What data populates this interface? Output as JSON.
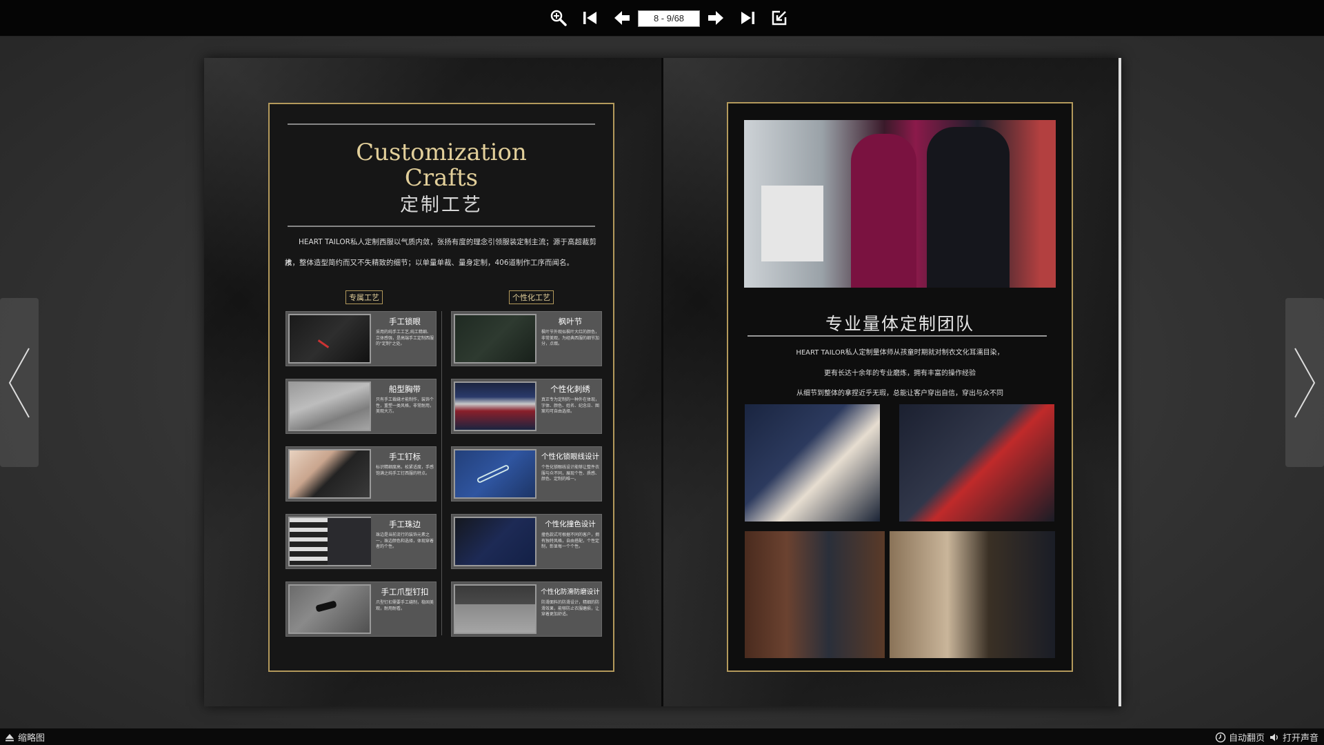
{
  "toolbar": {
    "page_indicator": "8 - 9/68",
    "buttons": [
      "zoom-in-icon",
      "first-page-icon",
      "prev-page-icon",
      "next-page-icon",
      "last-page-icon",
      "exit-fullscreen-icon"
    ]
  },
  "bottombar": {
    "thumbnails_label": "缩略图",
    "auto_flip_label": "自动翻页",
    "sound_label": "打开声音"
  },
  "left_page": {
    "title_en_1": "Customization",
    "title_en_2": "Crafts",
    "title_cn": "定制工艺",
    "intro_1": "HEART TAILOR私人定制西服以气质内敛，张扬有度的理念引领服装定制主流；源于高超裁剪技",
    "intro_2": "术，整体造型简约而又不失精致的细节；以单量单裁、量身定制，406道制作工序而闻名。",
    "col1_label": "专属工艺",
    "col2_label": "个性化工艺",
    "cards_left": [
      {
        "title": "手工锁眼",
        "desc": "采用的纯手工工艺,纯工精细、立体感强，是高端手工定制西服的\"定制\"之处。"
      },
      {
        "title": "船型胸带",
        "desc": "只有手工裁缝才能制作，装饰个性，重塑一类风格，非常耐用，美观大方。"
      },
      {
        "title": "手工钉标",
        "desc": "标识精细度高，松紧适度，手感饱满之纯手工钉西服的特点。"
      },
      {
        "title": "手工珠边",
        "desc": "珠边是当前流行的装饰元素之一，珠边颜色和选择，体现穿着者的个性。"
      },
      {
        "title": "手工爪型钉扣",
        "desc": "爪型钉扣需要手工缝制，稳固美观，耐用耐看。"
      }
    ],
    "cards_right": [
      {
        "title": "枫叶节",
        "desc": "枫叶节外观似枫叶大红的颜色，非常美观，为经典西服的细节加分，点缀。"
      },
      {
        "title": "个性化刺绣",
        "desc": "真正专为定制的一种外在体现，字体、颜色、姓名、纪念日、图案均可自由选择。"
      },
      {
        "title": "个性化锁眼线设计",
        "desc": "个性化锁眼线设计能够让整件衣服与众不同，展现个性、质感、颜色、定制的唯一。"
      },
      {
        "title": "个性化撞色设计",
        "desc": "撞色款式可根据不同的客户，拥有独特风格，自由搭配，个性定制，彰显每一个个性。"
      },
      {
        "title": "个性化防滑防磨设计",
        "desc": "防滑面料的防滑设计，精细的防滑效果，能够防止衣服磨损，让穿着更加舒适。"
      }
    ]
  },
  "right_page": {
    "team_title": "专业量体定制团队",
    "line_1": "HEART TAILOR私人定制量体师从孩童时期就对制衣文化耳濡目染，",
    "line_2": "更有长达十余年的专业磨炼，拥有丰富的操作经验",
    "line_3": "从细节到整体的拿捏近乎无瑕，总能让客户穿出自信，穿出与众不同"
  },
  "colors": {
    "gold": "#b49a5c",
    "title_gold": "#e2cf9a",
    "toolbar_bg": "#050505"
  }
}
